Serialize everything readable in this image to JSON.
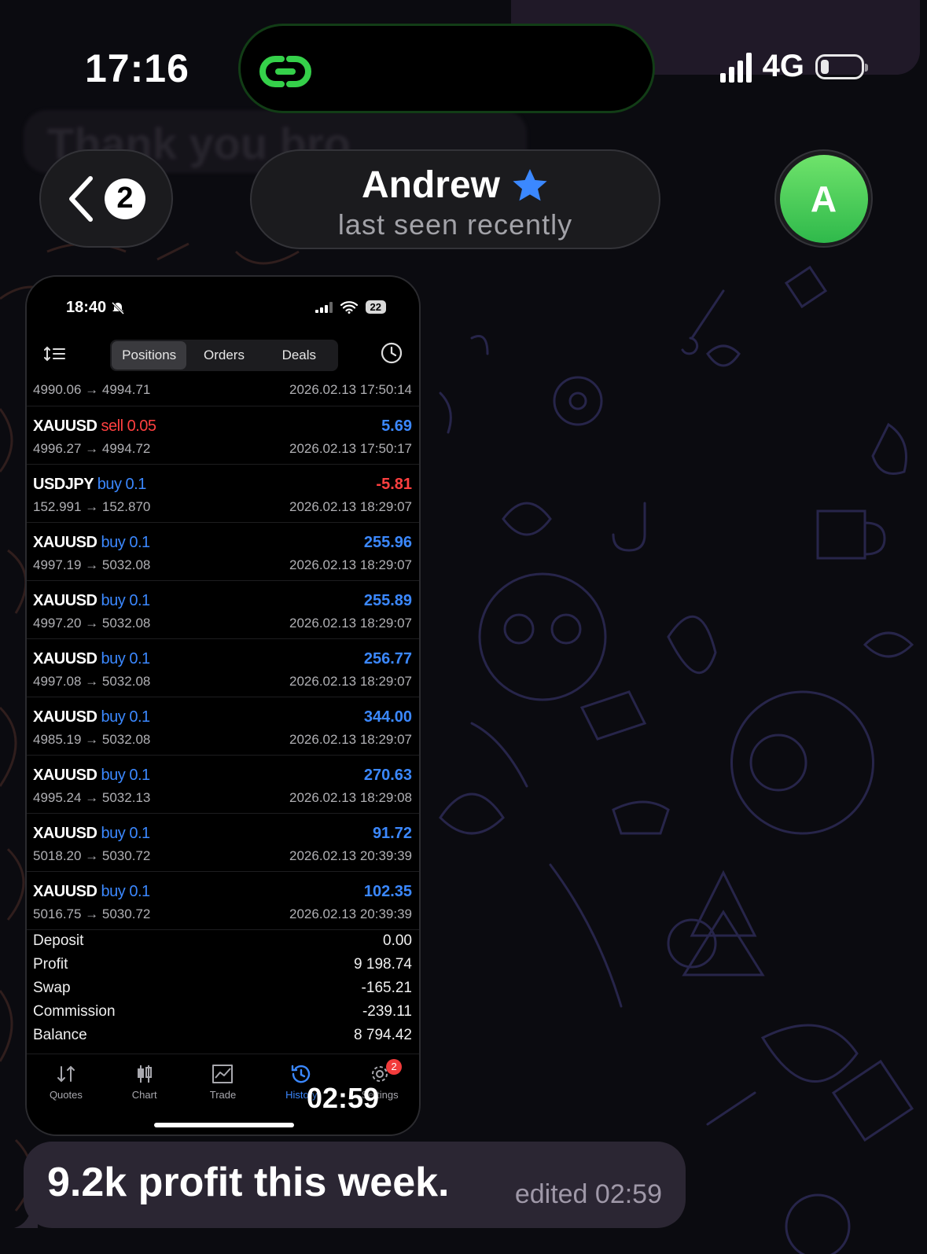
{
  "status_bar": {
    "time": "17:16",
    "network": "4G"
  },
  "header": {
    "back_count": "2",
    "contact_name": "Andrew",
    "contact_status": "last seen recently",
    "avatar_letter": "A",
    "avatar_color": "#3fc157"
  },
  "background_message": "Thank you bro",
  "screenshot": {
    "status_time": "18:40",
    "battery": "22",
    "tabs": [
      {
        "label": "Positions",
        "active": true
      },
      {
        "label": "Orders",
        "active": false
      },
      {
        "label": "Deals",
        "active": false
      }
    ],
    "first_row": {
      "prices": "4990.06 → 4994.71",
      "date": "2026.02.13 17:50:14"
    },
    "rows": [
      {
        "symbol": "XAUUSD",
        "side": "sell 0.05",
        "side_type": "sell",
        "profit": "5.69",
        "profit_color": "#3b88ff",
        "prices": "4996.27 → 4994.72",
        "date": "2026.02.13 17:50:17"
      },
      {
        "symbol": "USDJPY",
        "side": "buy 0.1",
        "side_type": "buy",
        "profit": "-5.81",
        "profit_color": "#ff4040",
        "prices": "152.991 → 152.870",
        "date": "2026.02.13 18:29:07"
      },
      {
        "symbol": "XAUUSD",
        "side": "buy 0.1",
        "side_type": "buy",
        "profit": "255.96",
        "profit_color": "#3b88ff",
        "prices": "4997.19 → 5032.08",
        "date": "2026.02.13 18:29:07"
      },
      {
        "symbol": "XAUUSD",
        "side": "buy 0.1",
        "side_type": "buy",
        "profit": "255.89",
        "profit_color": "#3b88ff",
        "prices": "4997.20 → 5032.08",
        "date": "2026.02.13 18:29:07"
      },
      {
        "symbol": "XAUUSD",
        "side": "buy 0.1",
        "side_type": "buy",
        "profit": "256.77",
        "profit_color": "#3b88ff",
        "prices": "4997.08 → 5032.08",
        "date": "2026.02.13 18:29:07"
      },
      {
        "symbol": "XAUUSD",
        "side": "buy 0.1",
        "side_type": "buy",
        "profit": "344.00",
        "profit_color": "#3b88ff",
        "prices": "4985.19 → 5032.08",
        "date": "2026.02.13 18:29:07"
      },
      {
        "symbol": "XAUUSD",
        "side": "buy 0.1",
        "side_type": "buy",
        "profit": "270.63",
        "profit_color": "#3b88ff",
        "prices": "4995.24 → 5032.13",
        "date": "2026.02.13 18:29:08"
      },
      {
        "symbol": "XAUUSD",
        "side": "buy 0.1",
        "side_type": "buy",
        "profit": "91.72",
        "profit_color": "#3b88ff",
        "prices": "5018.20 → 5030.72",
        "date": "2026.02.13 20:39:39"
      },
      {
        "symbol": "XAUUSD",
        "side": "buy 0.1",
        "side_type": "buy",
        "profit": "102.35",
        "profit_color": "#3b88ff",
        "prices": "5016.75 → 5030.72",
        "date": "2026.02.13 20:39:39"
      }
    ],
    "summary": [
      {
        "label": "Deposit",
        "value": "0.00"
      },
      {
        "label": "Profit",
        "value": "9 198.74"
      },
      {
        "label": "Swap",
        "value": "-165.21"
      },
      {
        "label": "Commission",
        "value": "-239.11"
      },
      {
        "label": "Balance",
        "value": "8 794.42"
      }
    ],
    "nav": [
      {
        "label": "Quotes",
        "icon": "quotes-icon"
      },
      {
        "label": "Chart",
        "icon": "chart-icon"
      },
      {
        "label": "Trade",
        "icon": "trade-icon"
      },
      {
        "label": "History",
        "icon": "history-icon",
        "active": true
      },
      {
        "label": "Settings",
        "icon": "settings-icon",
        "badge": "2"
      }
    ],
    "video_time": "02:59"
  },
  "message": {
    "text": "9.2k profit this week.",
    "meta": "edited 02:59"
  },
  "colors": {
    "accent_blue": "#3b88ff",
    "loss_red": "#ff4040",
    "bubble": "#2b2633",
    "island_border": "#123d16",
    "island_icon": "#35d04a"
  }
}
